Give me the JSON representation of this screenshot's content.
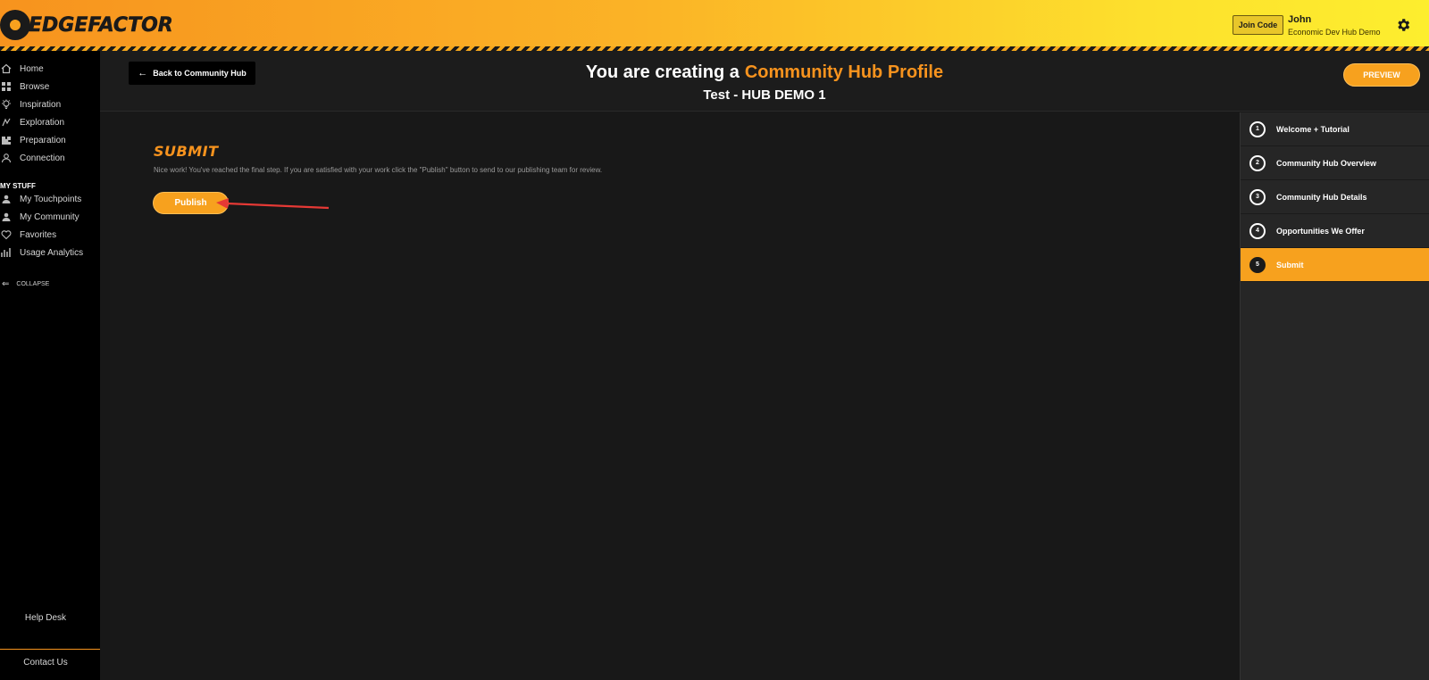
{
  "brand": {
    "logo_text_1": "EDGE",
    "logo_text_2": "FACTOR"
  },
  "topbar": {
    "join_code_label": "Join Code",
    "user_name": "John",
    "user_org": "Economic Dev Hub Demo",
    "settings_icon": "gear-icon"
  },
  "sidebar": {
    "items": [
      {
        "label": "Home",
        "icon": "home-icon"
      },
      {
        "label": "Browse",
        "icon": "grid-icon"
      },
      {
        "label": "Inspiration",
        "icon": "lightbulb-icon"
      },
      {
        "label": "Exploration",
        "icon": "compass-icon"
      },
      {
        "label": "Preparation",
        "icon": "puzzle-icon"
      },
      {
        "label": "Connection",
        "icon": "person-icon"
      }
    ],
    "section_label": "MY STUFF",
    "my_items": [
      {
        "label": "My Touchpoints",
        "icon": "touchpoints-icon"
      },
      {
        "label": "My Community",
        "icon": "community-icon"
      },
      {
        "label": "Favorites",
        "icon": "heart-icon"
      },
      {
        "label": "Usage Analytics",
        "icon": "analytics-icon"
      }
    ],
    "collapse_label": "COLLAPSE",
    "help_desk": "Help Desk",
    "contact_us": "Contact Us"
  },
  "header": {
    "back_label": "Back to Community Hub",
    "title_prefix": "You are creating a",
    "title_accent": "Community Hub Profile",
    "subtitle": "Test - HUB DEMO 1",
    "preview_label": "PREVIEW"
  },
  "main": {
    "section_title": "SUBMIT",
    "description": "Nice work! You've reached the final step. If you are satisfied with your work click the \"Publish\" button to send to our publishing team for review.",
    "publish_label": "Publish"
  },
  "steps": [
    {
      "num": "1",
      "label": "Welcome + Tutorial",
      "active": false
    },
    {
      "num": "2",
      "label": "Community Hub Overview",
      "active": false
    },
    {
      "num": "3",
      "label": "Community Hub Details",
      "active": false
    },
    {
      "num": "4",
      "label": "Opportunities We Offer",
      "active": false
    },
    {
      "num": "5",
      "label": "Submit",
      "active": true
    }
  ],
  "colors": {
    "accent": "#f7931e",
    "button": "#f7a11e",
    "annotation": "#e53935"
  }
}
